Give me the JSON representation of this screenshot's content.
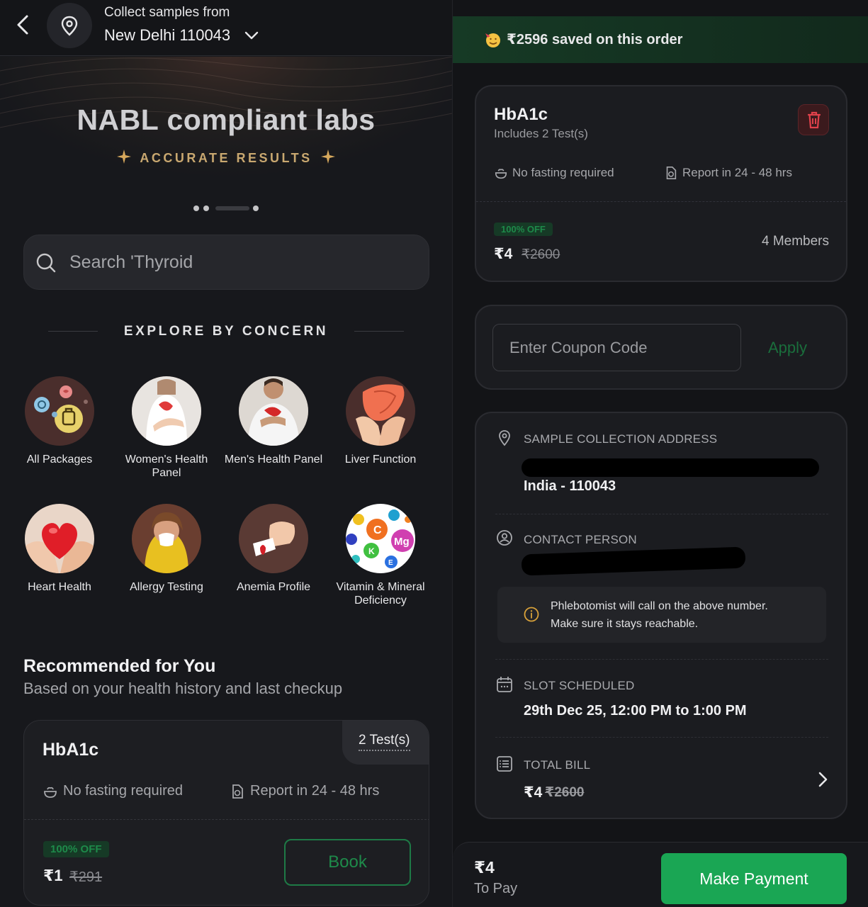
{
  "header": {
    "collect_label": "Collect samples from",
    "location": "New Delhi 110043"
  },
  "hero": {
    "title": "NABL compliant labs",
    "subtitle": "ACCURATE RESULTS"
  },
  "search": {
    "placeholder": "Search 'Thyroid"
  },
  "explore": {
    "heading": "EXPLORE BY CONCERN",
    "items": [
      {
        "label": "All Packages"
      },
      {
        "label": "Women's Health Panel"
      },
      {
        "label": "Men's Health Panel"
      },
      {
        "label": "Liver Function"
      },
      {
        "label": "Heart Health"
      },
      {
        "label": "Allergy Testing"
      },
      {
        "label": "Anemia Profile"
      },
      {
        "label": "Vitamin & Mineral Deficiency"
      }
    ]
  },
  "recommended": {
    "title": "Recommended for You",
    "subtitle": "Based on your health history and last checkup",
    "card": {
      "name": "HbA1c",
      "tests": "2 Test(s)",
      "fasting": "No fasting required",
      "report": "Report in 24 - 48 hrs",
      "discount": "100% OFF",
      "price": "₹1",
      "mrp": "₹291",
      "book_label": "Book"
    }
  },
  "order": {
    "saved_text": "₹2596 saved on this order",
    "item": {
      "name": "HbA1c",
      "includes": "Includes 2 Test(s)",
      "fasting": "No fasting required",
      "report": "Report in 24 - 48 hrs",
      "discount": "100% OFF",
      "price": "₹4",
      "mrp": "₹2600",
      "members": "4 Members"
    },
    "coupon": {
      "placeholder": "Enter Coupon Code",
      "apply_label": "Apply"
    },
    "address": {
      "label": "SAMPLE COLLECTION ADDRESS",
      "value": "India - 110043"
    },
    "contact": {
      "label": "CONTACT PERSON",
      "note_line1": "Phlebotomist will call on the above number.",
      "note_line2": "Make sure it stays reachable."
    },
    "slot": {
      "label": "SLOT SCHEDULED",
      "value": "29th Dec 25, 12:00 PM to 1:00 PM"
    },
    "total": {
      "label": "TOTAL BILL",
      "price": "₹4",
      "mrp": "₹2600"
    },
    "pay": {
      "amount": "₹4",
      "label": "To Pay",
      "button": "Make Payment"
    }
  },
  "colors": {
    "accent_green": "#1aa654",
    "gold": "#c9a870",
    "danger": "#e0414b"
  }
}
